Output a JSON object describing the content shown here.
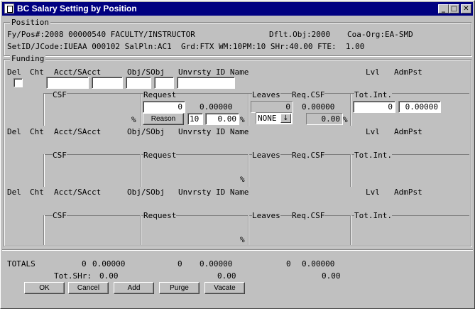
{
  "window": {
    "title": "BC Salary Setting by Position"
  },
  "position": {
    "legend": "Position",
    "line1": "Fy/Pos#:2008 00000540 FACULTY/INSTRUCTOR",
    "dflt_obj": "Dflt.Obj:2000",
    "coa_org": "Coa-Org:EA-SMD",
    "line2": "SetID/JCode:IUEAA 000102 SalPln:AC1  Grd:FTX WM:10PM:10 SHr:40.00 FTE:  1.00"
  },
  "funding": {
    "legend": "Funding",
    "header": {
      "del": "Del",
      "cht": "Cht",
      "acct": "Acct/SAcct",
      "obj": "Obj/SObj",
      "unvrsty": "Unvrsty ID Name",
      "lvl": "Lvl",
      "admpst": "AdmPst"
    },
    "sub_header": {
      "csf": "CSF",
      "request": "Request",
      "leaves": "Leaves",
      "req_csf": "Req.CSF",
      "tot_int": "Tot.Int."
    },
    "pct_sign": "%",
    "row1": {
      "request_amount": "0",
      "request_fte": "0.00000",
      "reason_label": "Reason",
      "months": "10",
      "percent": "0.00",
      "leaves_amount": "0",
      "req_csf_fte": "0.00000",
      "leave_code": "NONE",
      "req_csf_pct": "0.00",
      "tot_int_amount": "0",
      "tot_int_fte": "0.00000"
    }
  },
  "totals": {
    "label": "TOTALS",
    "csf_amount": "0",
    "csf_fte": "0.00000",
    "req_amount": "0",
    "req_fte": "0.00000",
    "leaves_amount": "0",
    "leaves_fte": "0.00000",
    "shr_label": "Tot.SHr:",
    "shr1": "0.00",
    "shr2": "0.00",
    "shr3": "0.00"
  },
  "buttons": {
    "ok": "OK",
    "cancel": "Cancel",
    "add": "Add",
    "purge": "Purge",
    "vacate": "Vacate"
  }
}
